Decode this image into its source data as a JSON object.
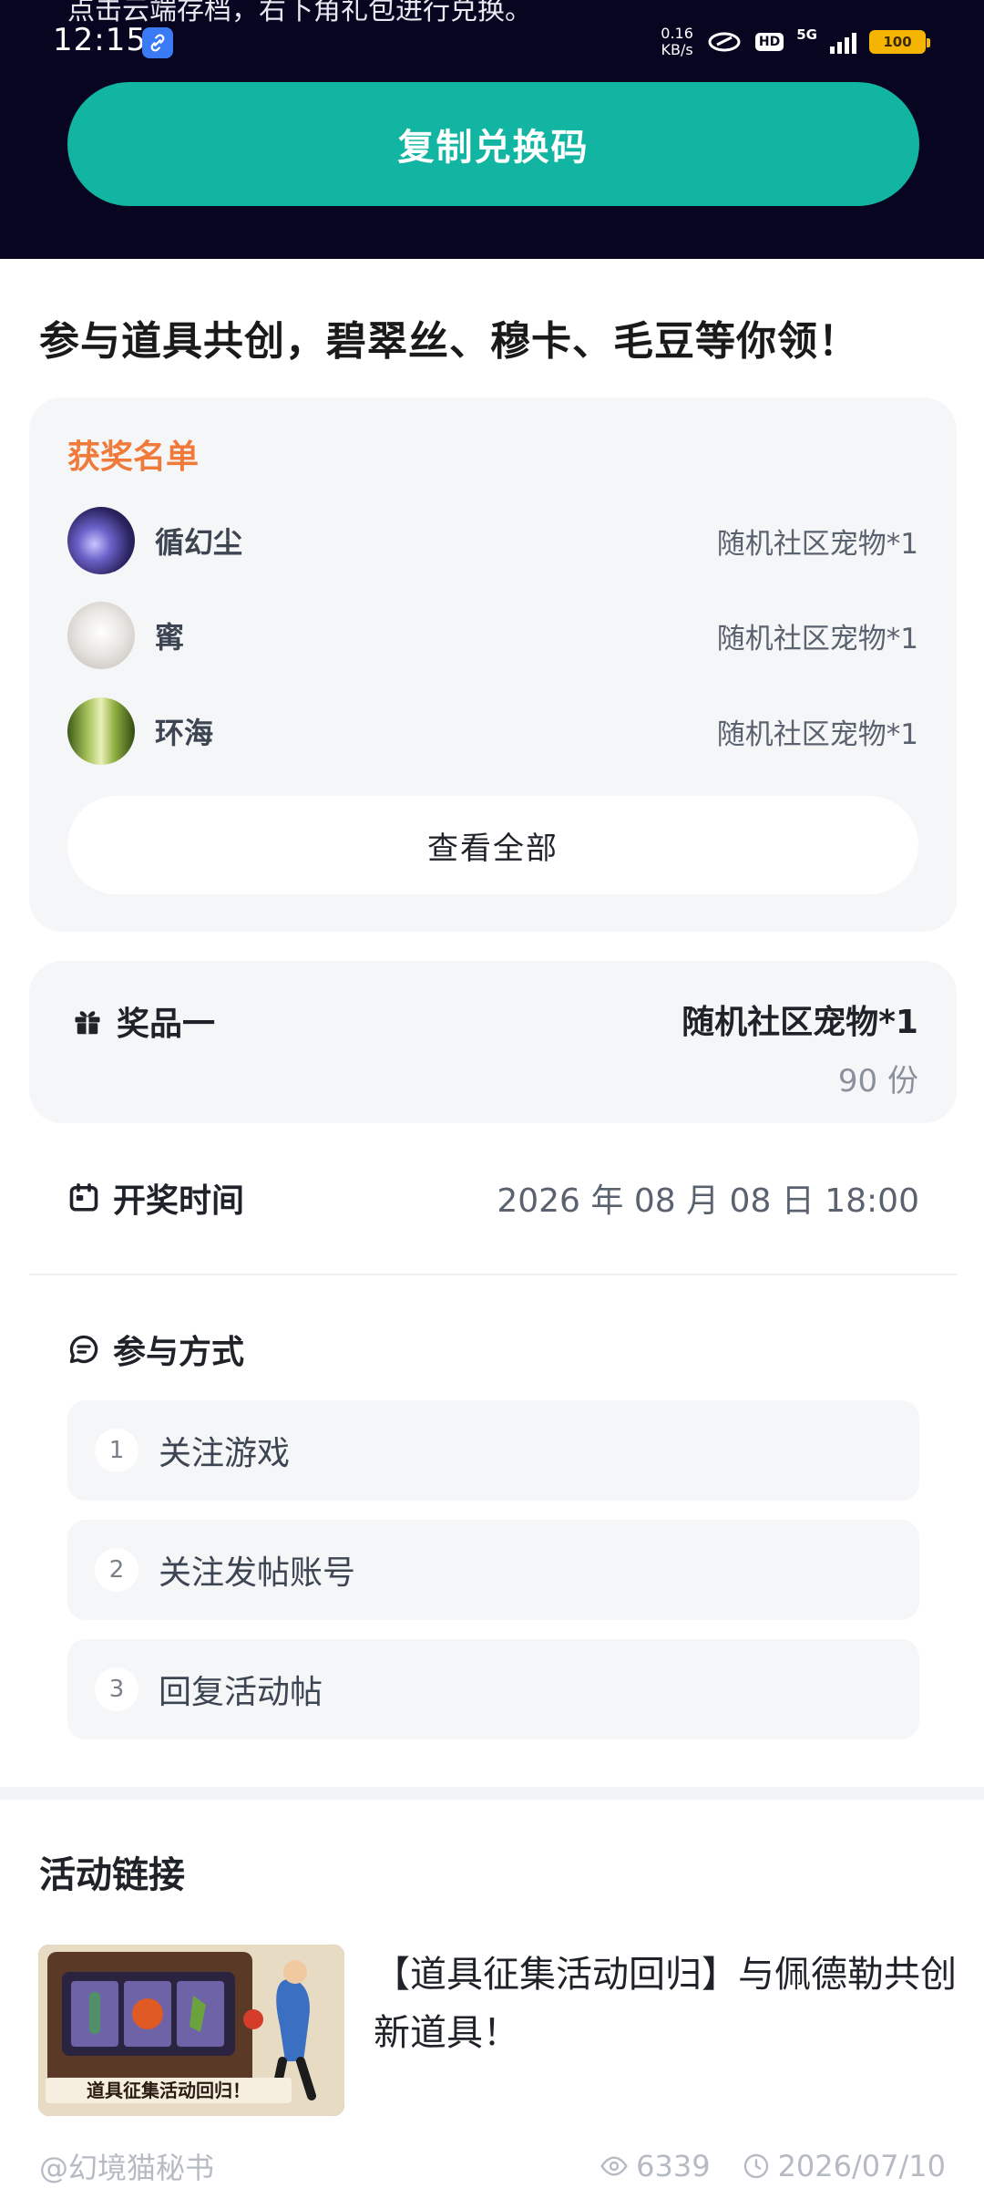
{
  "top": {
    "cutoff_text": "点击云端存档，右下角礼包进行兑换。",
    "status": {
      "time": "12:15",
      "net_speed_value": "0.16",
      "net_speed_unit": "KB/s",
      "hd": "HD",
      "network": "5G",
      "battery": "100"
    },
    "copy_button": "复制兑换码"
  },
  "headline": "参与道具共创，碧翠丝、穆卡、毛豆等你领！",
  "winners": {
    "title": "获奖名单",
    "rows": [
      {
        "name": "循幻尘",
        "prize": "随机社区宠物*1"
      },
      {
        "name": "寗",
        "prize": "随机社区宠物*1"
      },
      {
        "name": "环海",
        "prize": "随机社区宠物*1"
      }
    ],
    "view_all": "查看全部"
  },
  "prize": {
    "label": "奖品一",
    "name": "随机社区宠物*1",
    "count": "90 份"
  },
  "draw": {
    "label": "开奖时间",
    "value": "2026 年 08 月 08 日 18:00"
  },
  "method": {
    "title": "参与方式",
    "steps": [
      {
        "num": "1",
        "text": "关注游戏"
      },
      {
        "num": "2",
        "text": "关注发帖账号"
      },
      {
        "num": "3",
        "text": "回复活动帖"
      }
    ]
  },
  "links": {
    "title": "活动链接",
    "item_title": "【道具征集活动回归】与佩德勒共创新道具！",
    "thumb_caption": "道具征集活动回归！"
  },
  "footer": {
    "author": "@幻境猫秘书",
    "views": "6339",
    "date": "2026/07/10"
  },
  "colors": {
    "accent": "#12b5a1",
    "winners_title": "#f07a3a",
    "banner_bg": "#07051f"
  }
}
